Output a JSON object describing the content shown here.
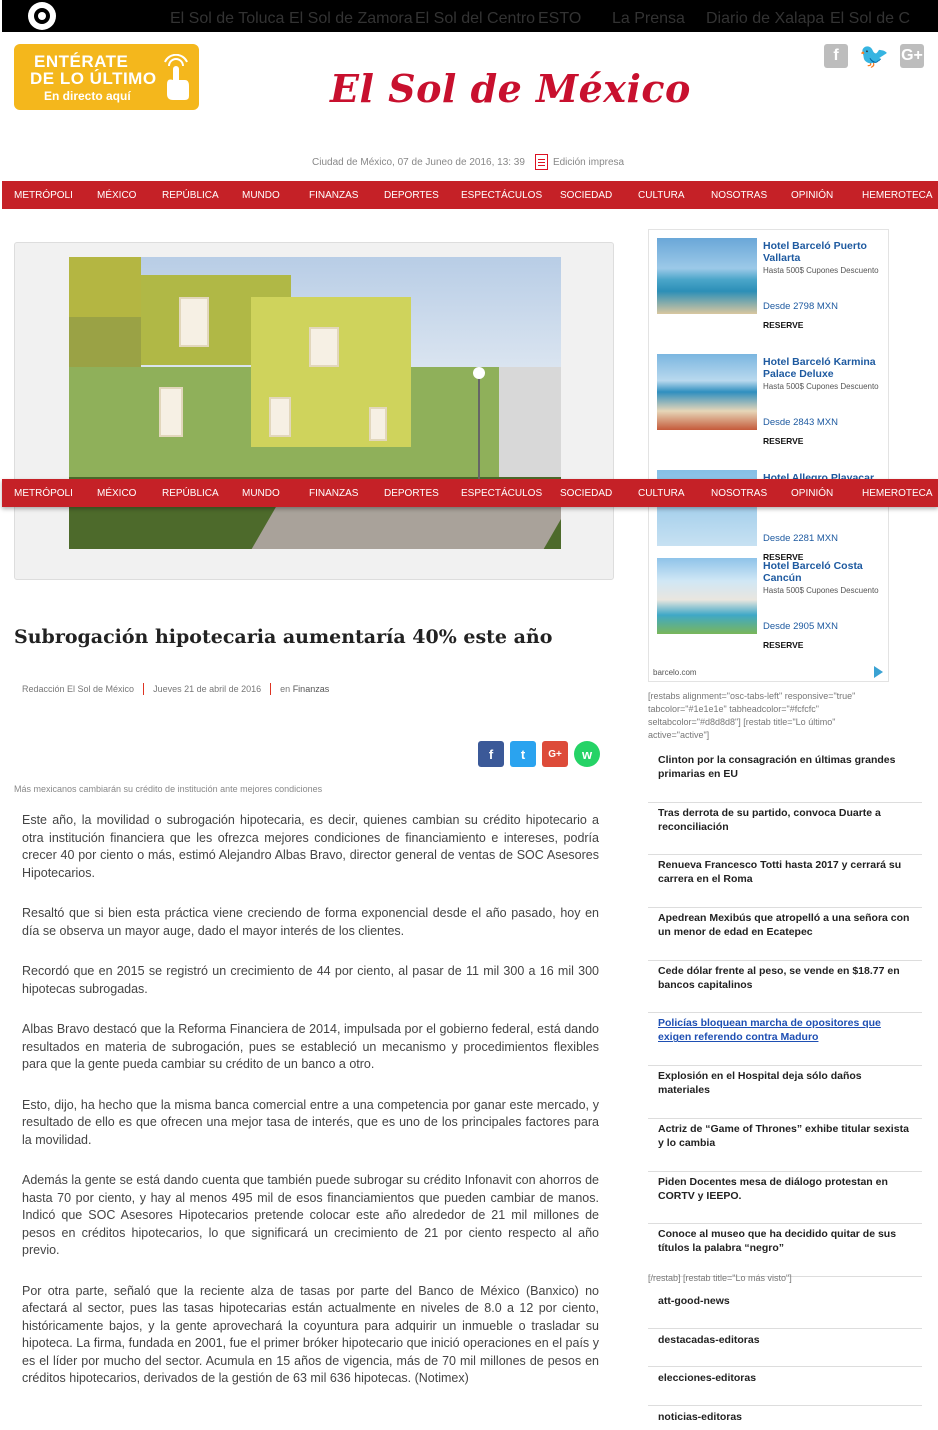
{
  "network_bar": {
    "sites": [
      "El Sol de Toluca",
      "El Sol de Zamora",
      "El Sol del Centro",
      "ESTO",
      "La Prensa",
      "Diario de Xalapa",
      "El Sol de C"
    ]
  },
  "header": {
    "promo_line1": "ENTÉRATE",
    "promo_line2": "DE LO ÚLTIMO",
    "promo_line3": "En directo aquí",
    "logo": "El Sol de México",
    "social": [
      "f",
      "t",
      "G+"
    ],
    "dateline": "Ciudad de México, 07 de Juneo de 2016, 13: 39",
    "print_edition": "Edición impresa"
  },
  "nav": {
    "items": [
      "METRÓPOLI",
      "MÉXICO",
      "REPÚBLICA",
      "MUNDO",
      "FINANZAS",
      "DEPORTES",
      "ESPECTÁCULOS",
      "SOCIEDAD",
      "CULTURA",
      "NOSOTRAS",
      "OPINIÓN",
      "HEMEROTECA"
    ]
  },
  "article": {
    "title": "Subrogación hipotecaria aumentaría 40% este año",
    "author": "Redacción El Sol de México",
    "date": "Jueves 21 de abril de 2016",
    "section_prefix": "en",
    "section": "Finanzas",
    "caption": "Más mexicanos cambiarán su crédito de institución ante mejores condiciones",
    "share": [
      "f",
      "t",
      "G+",
      "w"
    ],
    "paragraphs": [
      "Este año, la movilidad o subrogación hipotecaria, es decir, quienes cambian su crédito hipotecario a otra institución financiera que les ofrezca mejores condiciones de financiamiento e intereses, podría crecer 40 por ciento o más, estimó Alejandro Albas Bravo, director general de ventas de SOC Asesores Hipotecarios.",
      "Resaltó que si bien esta práctica viene creciendo de forma exponencial desde el año pasado, hoy en día se observa un mayor auge, dado el mayor interés de los clientes.",
      "Recordó que en 2015 se registró un crecimiento de 44 por ciento, al pasar de 11 mil 300 a 16 mil 300 hipotecas subrogadas.",
      "Albas Bravo destacó que la Reforma Financiera de 2014, impulsada por el gobierno federal, está dando resultados en materia de subrogación, pues se estableció un mecanismo y procedimientos flexibles para que la gente pueda cambiar su crédito de un banco a otro.",
      "Esto, dijo, ha hecho que la misma banca comercial entre a una competencia por ganar este mercado, y resultado de ello es que ofrecen una mejor tasa de interés, que es uno de los principales factores para la movilidad.",
      "Además la gente se está dando cuenta que también puede subrogar su crédito Infonavit con ahorros de hasta 70 por ciento, y hay al menos 495 mil de esos financiamientos que pueden cambiar de manos. Indicó que SOC Asesores Hipotecarios pretende colocar este año alrededor de 21 mil millones de pesos en créditos hipotecarios, lo que significará un crecimiento de 21 por ciento respecto al año previo.",
      "Por otra parte, señaló que la reciente alza de tasas por parte del Banco de México (Banxico) no afectará al sector, pues las tasas hipotecarias están actualmente en niveles de 8.0 a 12 por ciento, históricamente bajos, y la gente aprovechará la coyuntura para adquirir un inmueble o trasladar su hipoteca. La firma, fundada en 2001, fue el primer bróker hipotecario que inició operaciones en el país y es el líder por mucho del sector. Acumula en 15 años de vigencia, más de 70 mil millones de pesos en créditos hipotecarios, derivados de la gestión de 63 mil 636 hipotecas. (Notimex)"
    ]
  },
  "ad": {
    "hotels": [
      {
        "name": "Hotel Barceló Puerto Vallarta",
        "promo": "Hasta 500$ Cupones Descuento",
        "price": "Desde 2798 MXN",
        "cta": "RESERVE"
      },
      {
        "name": "Hotel Barceló Karmina Palace Deluxe",
        "promo": "Hasta 500$ Cupones Descuento",
        "price": "Desde 2843 MXN",
        "cta": "RESERVE"
      },
      {
        "name": "Hotel Allegro Playacar",
        "promo": "",
        "price": "Desde 2281 MXN",
        "cta": "RESERVE"
      },
      {
        "name": "Hotel Barceló Costa Cancún",
        "promo": "Hasta 500$ Cupones Descuento",
        "price": "Desde 2905 MXN",
        "cta": "RESERVE"
      }
    ],
    "domain": "barcelo.com"
  },
  "sidebar": {
    "shortcode": "[restabs alignment=\"osc-tabs-left\" responsive=\"true\" tabcolor=\"#1e1e1e\" tabheadcolor=\"#fcfcfc\" seltabcolor=\"#d8d8d8\"] [restab title=\"Lo último\" active=\"active\"]",
    "news": [
      "Clinton por la consagración en últimas grandes primarias en EU",
      "Tras derrota de su partido, convoca Duarte a reconciliación",
      "Renueva Francesco Totti hasta 2017 y cerrará su carrera en el Roma",
      "Apedrean Mexibús que atropelló a una señora con un menor de edad en Ecatepec",
      "Cede dólar frente al peso, se vende en $18.77 en bancos capitalinos",
      "Policías bloquean marcha de opositores que exigen referendo contra Maduro",
      "Explosión en el Hospital deja sólo daños materiales",
      "Actriz de “Game of Thrones” exhibe titular sexista y lo cambia",
      "Piden Docentes mesa de diálogo protestan en CORTV y IEEPO.",
      "Conoce al museo que ha decidido quitar de sus títulos la palabra “negro”"
    ],
    "restab_end": "[/restab] [restab title=\"Lo más visto\"]",
    "tags": [
      "att-good-news",
      "destacadas-editoras",
      "elecciones-editoras",
      "noticias-editoras"
    ]
  }
}
